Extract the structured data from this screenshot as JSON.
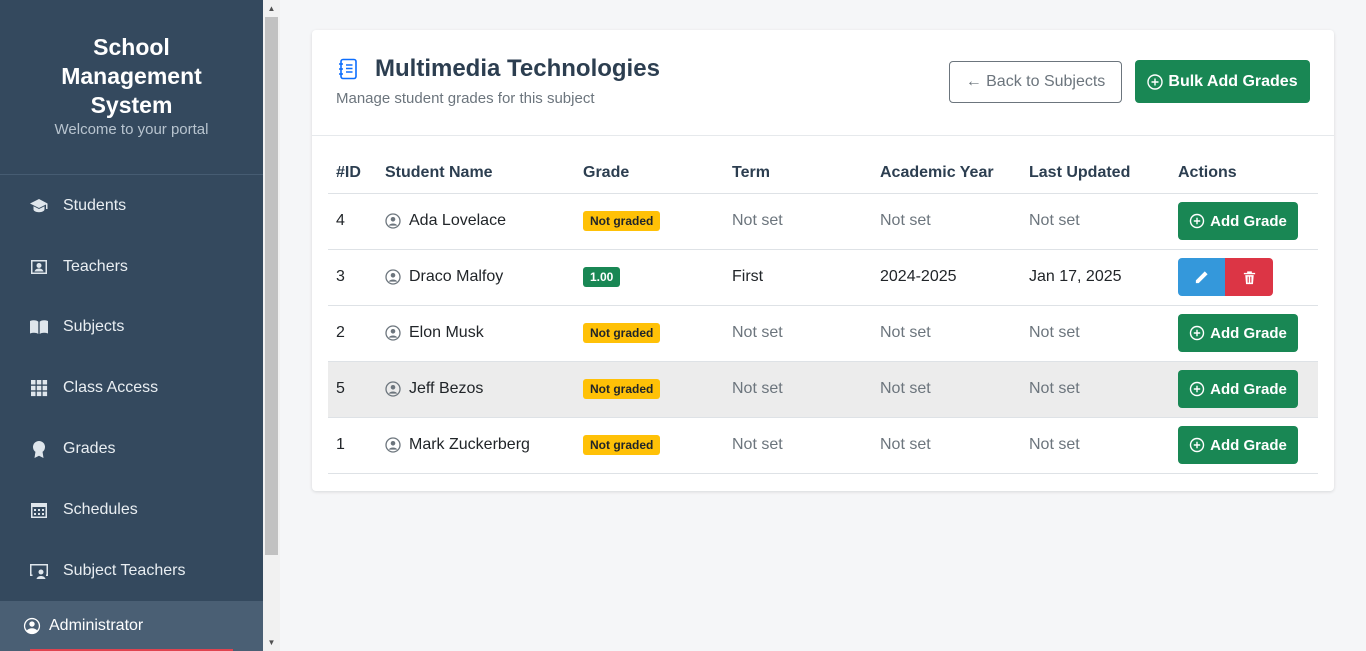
{
  "sidebar": {
    "brand_line1": "School",
    "brand_line2": "Management",
    "brand_line3": "System",
    "subtitle": "Welcome to your portal",
    "items": [
      {
        "label": "Students",
        "icon": "graduation-cap-icon"
      },
      {
        "label": "Teachers",
        "icon": "person-badge-icon"
      },
      {
        "label": "Subjects",
        "icon": "book-icon"
      },
      {
        "label": "Class Access",
        "icon": "grid-icon"
      },
      {
        "label": "Grades",
        "icon": "award-icon"
      },
      {
        "label": "Schedules",
        "icon": "calendar-icon"
      },
      {
        "label": "Subject Teachers",
        "icon": "person-video-icon"
      }
    ],
    "user": "Administrator"
  },
  "header": {
    "title": "Multimedia Technologies",
    "subtitle": "Manage student grades for this subject",
    "back_label": "← Back to Subjects",
    "bulk_label": "Bulk Add Grades"
  },
  "table": {
    "headers": [
      "#ID",
      "Student Name",
      "Grade",
      "Term",
      "Academic Year",
      "Last Updated",
      "Actions"
    ],
    "add_label": "Add Grade",
    "rows": [
      {
        "id": "4",
        "name": "Ada Lovelace",
        "grade": "Not graded",
        "term": "Not set",
        "year": "Not set",
        "updated": "Not set"
      },
      {
        "id": "3",
        "name": "Draco Malfoy",
        "grade": "1.00",
        "term": "First",
        "year": "2024-2025",
        "updated": "Jan 17, 2025"
      },
      {
        "id": "2",
        "name": "Elon Musk",
        "grade": "Not graded",
        "term": "Not set",
        "year": "Not set",
        "updated": "Not set"
      },
      {
        "id": "5",
        "name": "Jeff Bezos",
        "grade": "Not graded",
        "term": "Not set",
        "year": "Not set",
        "updated": "Not set"
      },
      {
        "id": "1",
        "name": "Mark Zuckerberg",
        "grade": "Not graded",
        "term": "Not set",
        "year": "Not set",
        "updated": "Not set"
      }
    ]
  },
  "colors": {
    "sidebar": "#34495e",
    "success": "#198754",
    "warning": "#ffc107",
    "edit": "#3498db",
    "danger": "#dc3545"
  }
}
